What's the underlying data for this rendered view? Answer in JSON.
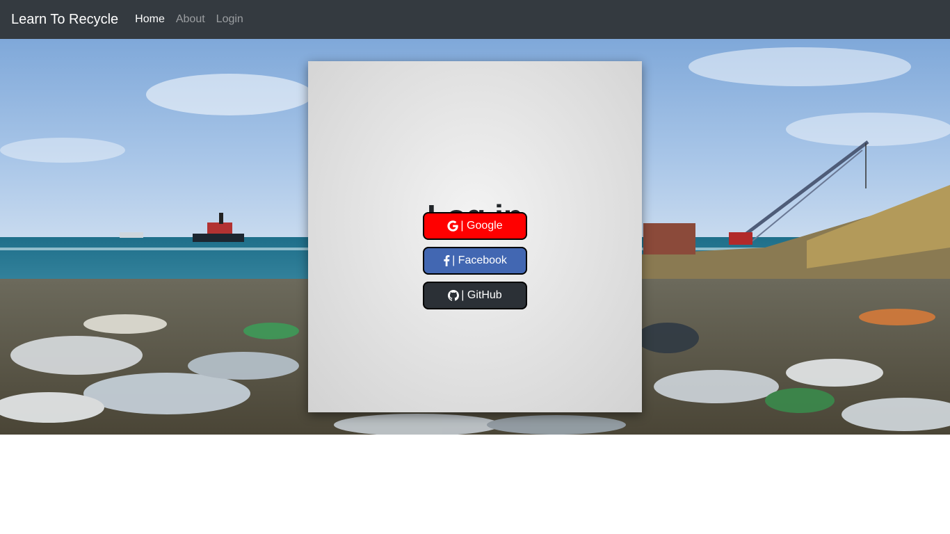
{
  "navbar": {
    "brand": "Learn To Recycle",
    "links": [
      "Home",
      "About",
      "Login"
    ]
  },
  "hero": {
    "image": "beach covered with plastic waste, sea with ships and a crane in the background"
  },
  "login": {
    "title": "Log in",
    "buttons": {
      "google": "| Google",
      "facebook": "| Facebook",
      "github": "| GitHub"
    }
  },
  "colors": {
    "navbar_bg": "#343a40",
    "google": "#ff0000",
    "facebook": "#4267b2",
    "github": "#2b3036"
  },
  "icons": [
    "google-icon",
    "facebook-icon",
    "github-icon"
  ]
}
